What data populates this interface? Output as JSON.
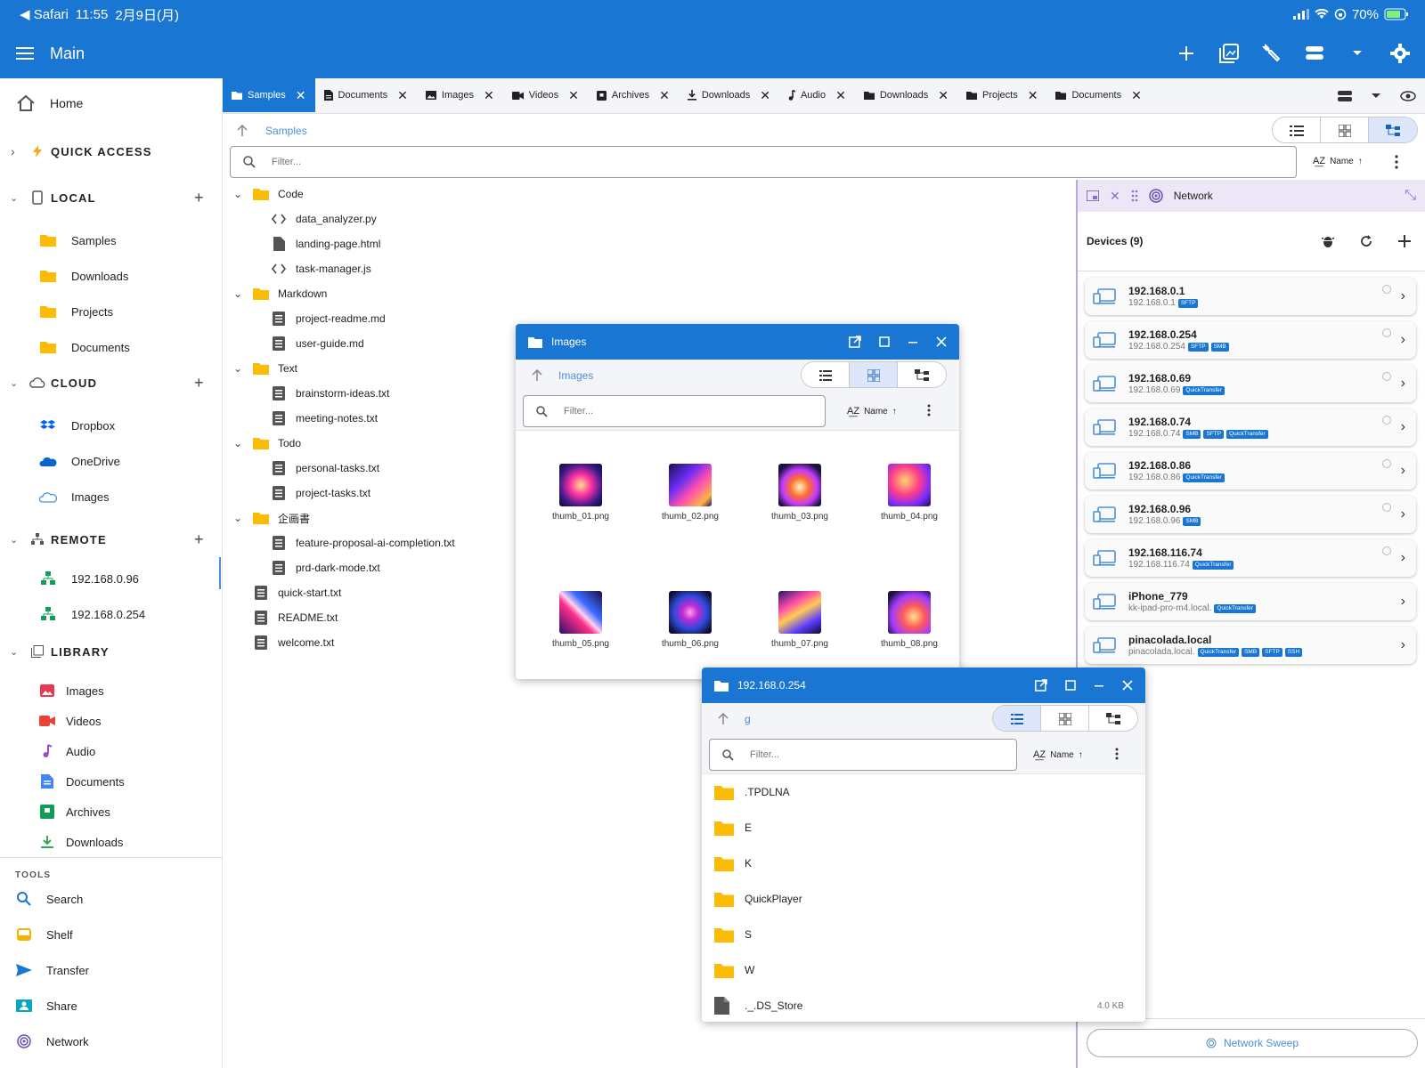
{
  "status_bar": {
    "back_app": "◀ Safari",
    "time": "11:55",
    "date": "2月9日(月)",
    "battery": "70%"
  },
  "app_bar": {
    "title": "Main"
  },
  "sidebar": {
    "home": "Home",
    "quick_access": "QUICK ACCESS",
    "local": {
      "header": "LOCAL",
      "items": [
        "Samples",
        "Downloads",
        "Projects",
        "Documents"
      ]
    },
    "cloud": {
      "header": "CLOUD",
      "items": [
        "Dropbox",
        "OneDrive",
        "Images"
      ]
    },
    "remote": {
      "header": "REMOTE",
      "items": [
        "192.168.0.96",
        "192.168.0.254"
      ]
    },
    "library": {
      "header": "LIBRARY",
      "items": [
        "Images",
        "Videos",
        "Audio",
        "Documents",
        "Archives",
        "Downloads"
      ]
    },
    "tools": {
      "header": "TOOLS",
      "items": [
        "Search",
        "Shelf",
        "Transfer",
        "Share",
        "Network"
      ]
    }
  },
  "tabs": [
    {
      "label": "Samples",
      "icon": "folder-icon"
    },
    {
      "label": "Documents",
      "icon": "document-icon"
    },
    {
      "label": "Images",
      "icon": "image-icon"
    },
    {
      "label": "Videos",
      "icon": "video-icon"
    },
    {
      "label": "Archives",
      "icon": "archive-icon"
    },
    {
      "label": "Downloads",
      "icon": "download-icon"
    },
    {
      "label": "Audio",
      "icon": "music-note-icon"
    },
    {
      "label": "Downloads",
      "icon": "folder-icon"
    },
    {
      "label": "Projects",
      "icon": "folder-icon"
    },
    {
      "label": "Documents",
      "icon": "folder-icon"
    }
  ],
  "main": {
    "breadcrumb": "Samples",
    "filter_placeholder": "Filter...",
    "sort_label": "Name",
    "tree": [
      {
        "name": "Code",
        "type": "folder",
        "depth": 0
      },
      {
        "name": "data_analyzer.py",
        "type": "code",
        "depth": 1
      },
      {
        "name": "landing-page.html",
        "type": "file",
        "depth": 1
      },
      {
        "name": "task-manager.js",
        "type": "code",
        "depth": 1
      },
      {
        "name": "Markdown",
        "type": "folder",
        "depth": 0
      },
      {
        "name": "project-readme.md",
        "type": "text",
        "depth": 1
      },
      {
        "name": "user-guide.md",
        "type": "text",
        "depth": 1
      },
      {
        "name": "Text",
        "type": "folder",
        "depth": 0
      },
      {
        "name": "brainstorm-ideas.txt",
        "type": "text",
        "depth": 1
      },
      {
        "name": "meeting-notes.txt",
        "type": "text",
        "depth": 1
      },
      {
        "name": "Todo",
        "type": "folder",
        "depth": 0
      },
      {
        "name": "personal-tasks.txt",
        "type": "text",
        "depth": 1
      },
      {
        "name": "project-tasks.txt",
        "type": "text",
        "depth": 1
      },
      {
        "name": "企画書",
        "type": "folder",
        "depth": 0
      },
      {
        "name": "feature-proposal-ai-completion.txt",
        "type": "text",
        "depth": 1
      },
      {
        "name": "prd-dark-mode.txt",
        "type": "text",
        "depth": 1
      },
      {
        "name": "quick-start.txt",
        "type": "text",
        "depth": 0
      },
      {
        "name": "README.txt",
        "type": "text",
        "depth": 0
      },
      {
        "name": "welcome.txt",
        "type": "text",
        "depth": 0
      }
    ]
  },
  "network_panel": {
    "title": "Network",
    "devices_header": "Devices (9)",
    "sweep_label": "Network Sweep",
    "devices": [
      {
        "name": "192.168.0.1",
        "sub": "192.168.0.1",
        "badges": [
          "SFTP"
        ],
        "dot": true
      },
      {
        "name": "192.168.0.254",
        "sub": "192.168.0.254",
        "badges": [
          "SFTP",
          "SMB"
        ],
        "dot": true
      },
      {
        "name": "192.168.0.69",
        "sub": "192.168.0.69",
        "badges": [
          "QuickTransfer"
        ],
        "dot": true
      },
      {
        "name": "192.168.0.74",
        "sub": "192.168.0.74",
        "badges": [
          "SMB",
          "SFTP",
          "QuickTransfer"
        ],
        "dot": true
      },
      {
        "name": "192.168.0.86",
        "sub": "192.168.0.86",
        "badges": [
          "QuickTransfer"
        ],
        "dot": true
      },
      {
        "name": "192.168.0.96",
        "sub": "192.168.0.96",
        "badges": [
          "SMB"
        ],
        "dot": true
      },
      {
        "name": "192.168.116.74",
        "sub": "192.168.116.74",
        "badges": [
          "QuickTransfer"
        ],
        "dot": true
      },
      {
        "name": "iPhone_779",
        "sub": "kk-ipad-pro-m4.local.",
        "badges": [
          "QuickTransfer"
        ],
        "dot": false
      },
      {
        "name": "pinacolada.local",
        "sub": "pinacolada.local.",
        "badges": [
          "QuickTransfer",
          "SMB",
          "SFTP",
          "SSH"
        ],
        "dot": false
      }
    ]
  },
  "images_window": {
    "title": "Images",
    "breadcrumb": "Images",
    "filter_placeholder": "Filter...",
    "sort_label": "Name",
    "thumbs": [
      "thumb_01.png",
      "thumb_02.png",
      "thumb_03.png",
      "thumb_04.png",
      "thumb_05.png",
      "thumb_06.png",
      "thumb_07.png",
      "thumb_08.png"
    ]
  },
  "remote_window": {
    "title": "192.168.0.254",
    "breadcrumb": "g",
    "filter_placeholder": "Filter...",
    "sort_label": "Name",
    "rows": [
      {
        "name": ".TPDLNA",
        "type": "folder",
        "size": ""
      },
      {
        "name": "E",
        "type": "folder",
        "size": ""
      },
      {
        "name": "K",
        "type": "folder",
        "size": ""
      },
      {
        "name": "QuickPlayer",
        "type": "folder",
        "size": ""
      },
      {
        "name": "S",
        "type": "folder",
        "size": ""
      },
      {
        "name": "W",
        "type": "folder",
        "size": ""
      },
      {
        "name": "._.DS_Store",
        "type": "file",
        "size": "4.0 KB"
      }
    ]
  },
  "colors": {
    "primary": "#1976d2",
    "folder": "#fbbc05",
    "link": "#4a90d9",
    "network_accent": "#b9a7e0"
  }
}
